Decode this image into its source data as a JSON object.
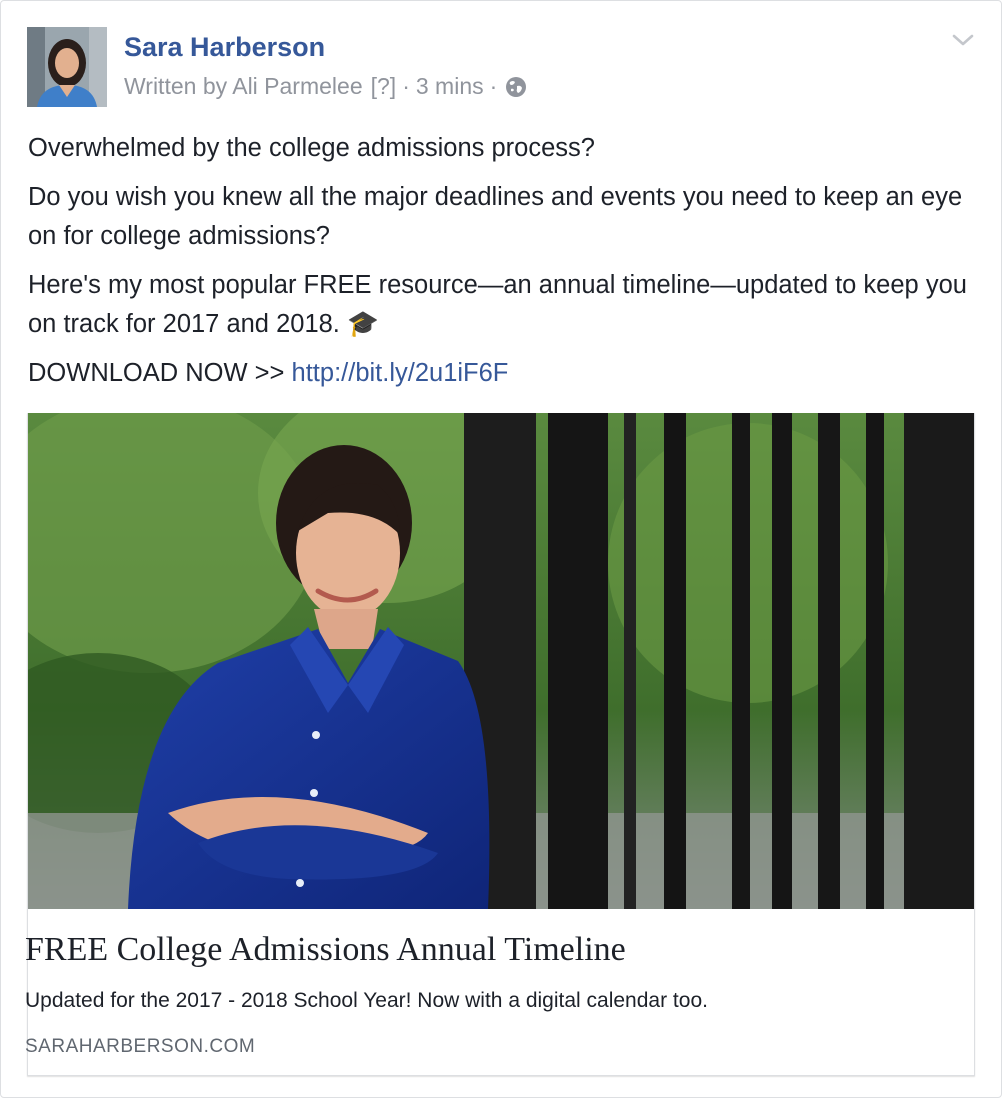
{
  "post": {
    "author": "Sara Harberson",
    "meta": {
      "written_by": "Written by Ali Parmelee",
      "help": "[?]",
      "separator": "·",
      "time": "3 mins",
      "privacy_icon": "globe-icon"
    },
    "menu_icon": "chevron-down-icon",
    "paragraphs": [
      "Overwhelmed by the college admissions process?",
      "Do you wish you knew all the major deadlines and events you need to keep an eye on for college admissions?",
      "Here's my most popular FREE resource—an annual timeline—updated to keep you on track for 2017 and 2018. 🎓"
    ],
    "cta_prefix": "DOWNLOAD NOW >> ",
    "cta_link": "http://bit.ly/2u1iF6F"
  },
  "link_card": {
    "title": "FREE College Admissions Annual Timeline",
    "description": "Updated for the 2017 - 2018 School Year! Now with a digital calendar too.",
    "domain": "SARAHARBERSON.COM"
  },
  "colors": {
    "link": "#365899",
    "text": "#1d2129",
    "meta": "#90949c",
    "border": "#dddfe2"
  }
}
